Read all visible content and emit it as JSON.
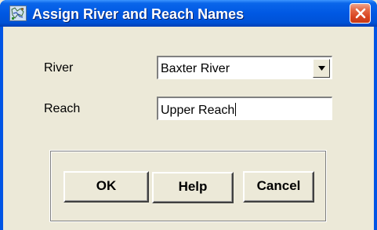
{
  "window": {
    "title": "Assign River and Reach Names",
    "icon": "hec-ras-app-icon",
    "close_icon": "close-icon"
  },
  "form": {
    "river": {
      "label": "River",
      "value": "Baxter River",
      "control": "dropdown"
    },
    "reach": {
      "label": "Reach",
      "value": "Upper Reach",
      "control": "text-input"
    }
  },
  "buttons": {
    "ok": "OK",
    "help": "Help",
    "cancel": "Cancel"
  },
  "colors": {
    "titlebar": "#0058e3",
    "close_button": "#d8431f",
    "dialog_background": "#ece9d8"
  }
}
